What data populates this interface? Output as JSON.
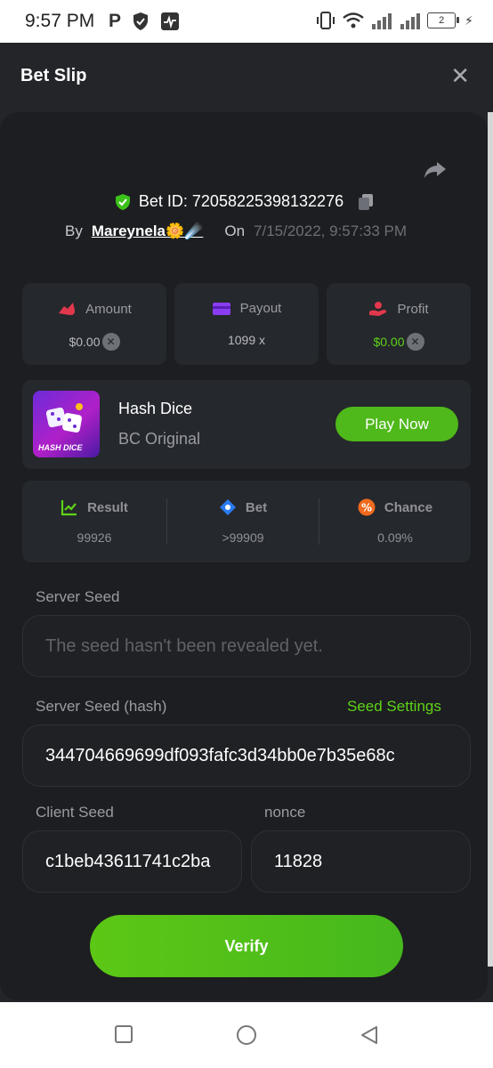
{
  "status_bar": {
    "time": "9:57 PM",
    "left_icons": [
      "parking-icon",
      "shield-icon",
      "pulse-icon"
    ],
    "right_icons": [
      "vibrate-icon",
      "wifi-icon",
      "signal-icon",
      "signal-icon"
    ],
    "battery_level": "2"
  },
  "header": {
    "title": "Bet Slip",
    "close_glyph": "✕"
  },
  "bet": {
    "id_label": "Bet ID: 72058225398132276",
    "by_label": "By",
    "username": "Mareynela🌼☄️",
    "on_label": "On",
    "date": "7/15/2022, 9:57:33 PM"
  },
  "stats": {
    "amount": {
      "label": "Amount",
      "value": "$0.00"
    },
    "payout": {
      "label": "Payout",
      "value": "1099 x"
    },
    "profit": {
      "label": "Profit",
      "value": "$0.00"
    }
  },
  "game": {
    "name": "Hash Dice",
    "subtitle": "BC Original",
    "thumb_text": "HASH DICE",
    "play_label": "Play Now"
  },
  "result": {
    "result": {
      "label": "Result",
      "value": "99926"
    },
    "bet": {
      "label": "Bet",
      "value": ">99909"
    },
    "chance": {
      "label": "Chance",
      "value": "0.09%"
    }
  },
  "seeds": {
    "server_seed_label": "Server Seed",
    "server_seed_placeholder": "The seed hasn't been revealed yet.",
    "server_hash_label": "Server Seed (hash)",
    "seed_settings_label": "Seed Settings",
    "server_hash_value": "344704669699df093fafc3d34bb0e7b35e68c",
    "client_seed_label": "Client Seed",
    "client_seed_value": "c1beb43611741c2ba",
    "nonce_label": "nonce",
    "nonce_value": "11828"
  },
  "verify_label": "Verify",
  "colors": {
    "accent_green": "#5fd318",
    "panel_bg": "#1c1e21",
    "card_bg": "#25282c"
  }
}
